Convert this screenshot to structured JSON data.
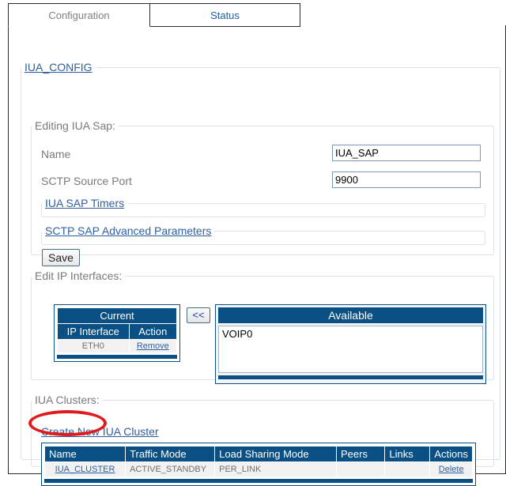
{
  "tabs": [
    {
      "label": "Configuration",
      "active": true
    },
    {
      "label": "Status",
      "active": false
    }
  ],
  "config_section": {
    "legend": "IUA_CONFIG",
    "editing": {
      "legend": "Editing IUA Sap:",
      "fields": [
        {
          "label": "Name",
          "value": "IUA_SAP",
          "placeholder": ""
        },
        {
          "label": "SCTP Source Port",
          "value": "9900",
          "placeholder": ""
        }
      ],
      "sub_sections": [
        {
          "legend": "IUA SAP Timers"
        },
        {
          "legend": "SCTP SAP Advanced Parameters"
        }
      ],
      "save_label": "Save"
    },
    "ip_interfaces": {
      "legend": "Edit IP Interfaces:",
      "current": {
        "title": "Current",
        "columns": [
          "IP Interface",
          "Action"
        ],
        "rows": [
          {
            "interface": "ETH0",
            "action": "Remove"
          }
        ]
      },
      "move_button_label": "<<",
      "available": {
        "title": "Available",
        "options": [
          "VOIP0"
        ]
      }
    },
    "clusters": {
      "legend": "IUA Clusters:",
      "create_link": "Create New IUA Cluster",
      "columns": [
        "Name",
        "Traffic Mode",
        "Load Sharing Mode",
        "Peers",
        "Links",
        "Actions"
      ],
      "rows": [
        {
          "name": "IUA_CLUSTER",
          "traffic_mode": "ACTIVE_STANDBY",
          "load_sharing_mode": "PER_LINK",
          "peers": "",
          "links": "",
          "actions": "Delete"
        }
      ]
    }
  },
  "colors": {
    "header_blue": "#0b5084",
    "link_blue": "#2f5fa0",
    "annotation_red": "#e01b1b",
    "label_gray": "#7a7a7a"
  }
}
